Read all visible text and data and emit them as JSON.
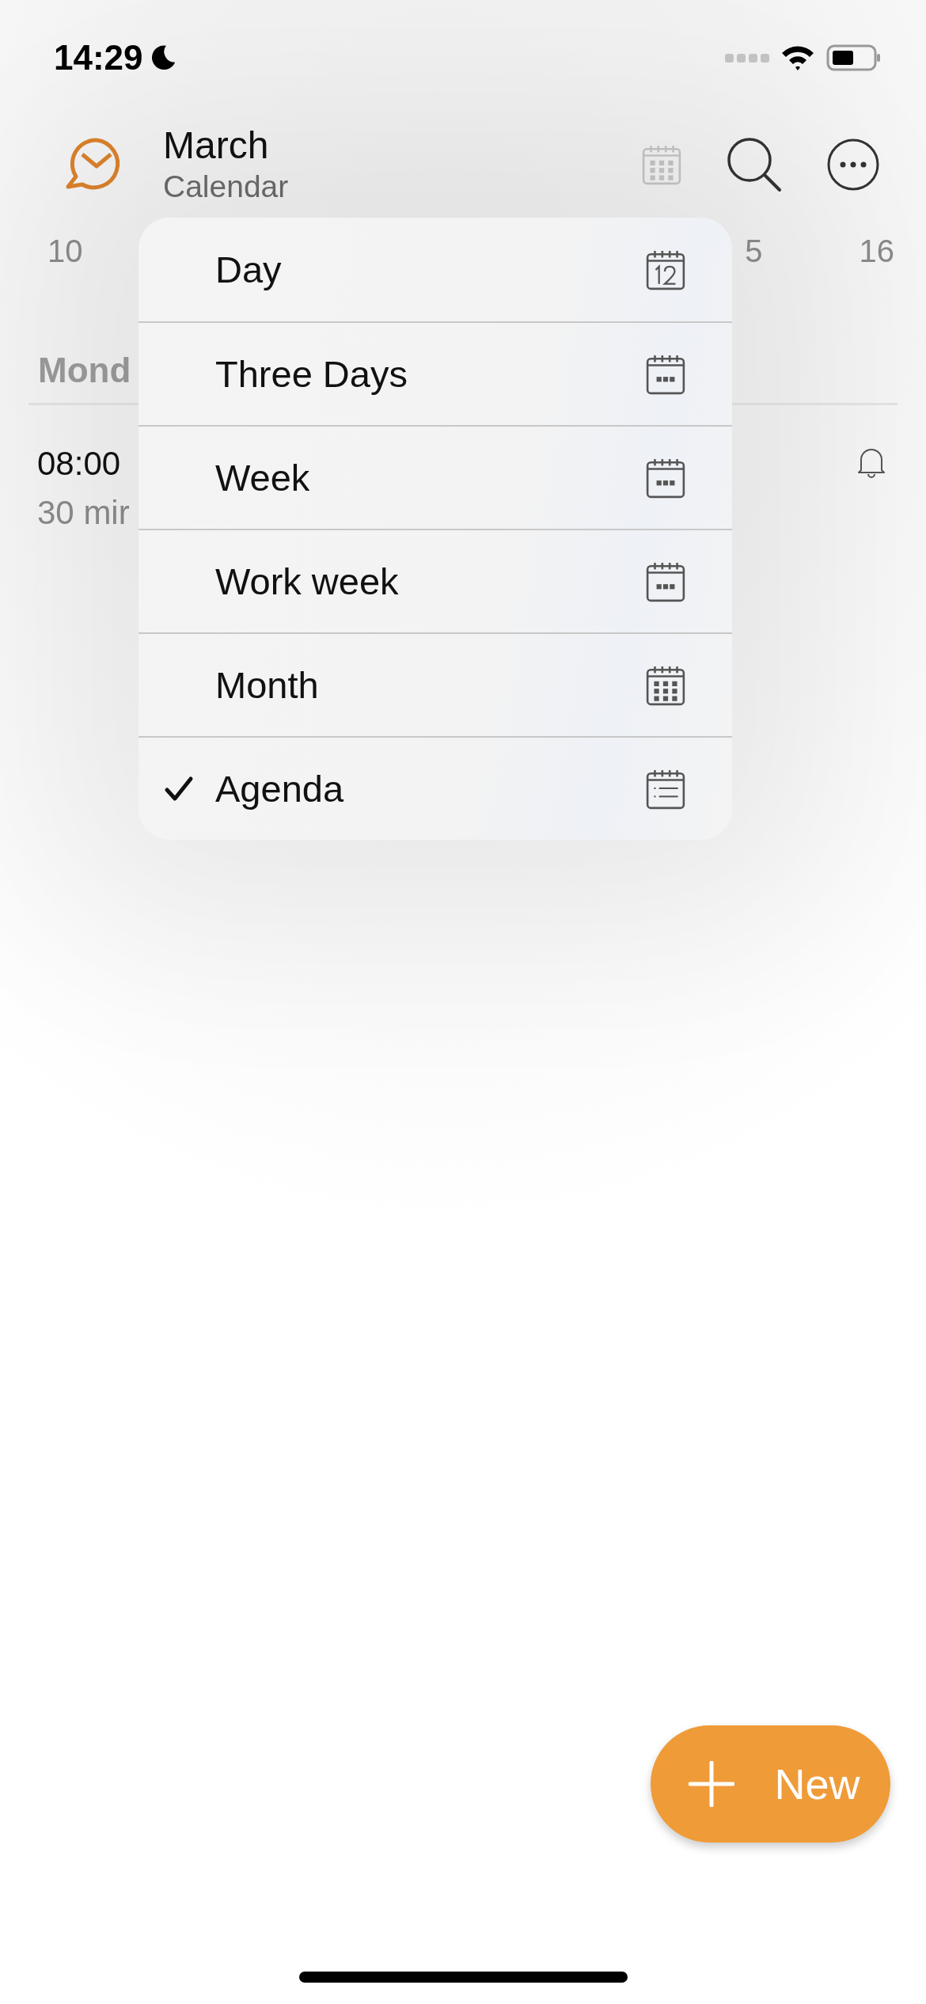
{
  "status_bar": {
    "time": "14:29"
  },
  "header": {
    "title": "March",
    "subtitle": "Calendar"
  },
  "week_days": [
    {
      "label": "10"
    },
    {
      "label": "5"
    },
    {
      "label": "16"
    }
  ],
  "section": {
    "heading": "Mond"
  },
  "event": {
    "time": "08:00",
    "duration": "30 mir"
  },
  "menu": {
    "items": [
      {
        "label": "Day",
        "kind": "day",
        "selected": false
      },
      {
        "label": "Three Days",
        "kind": "days",
        "selected": false
      },
      {
        "label": "Week",
        "kind": "days",
        "selected": false
      },
      {
        "label": "Work week",
        "kind": "days",
        "selected": false
      },
      {
        "label": "Month",
        "kind": "month",
        "selected": false
      },
      {
        "label": "Agenda",
        "kind": "list",
        "selected": true
      }
    ]
  },
  "fab": {
    "label": "New"
  }
}
